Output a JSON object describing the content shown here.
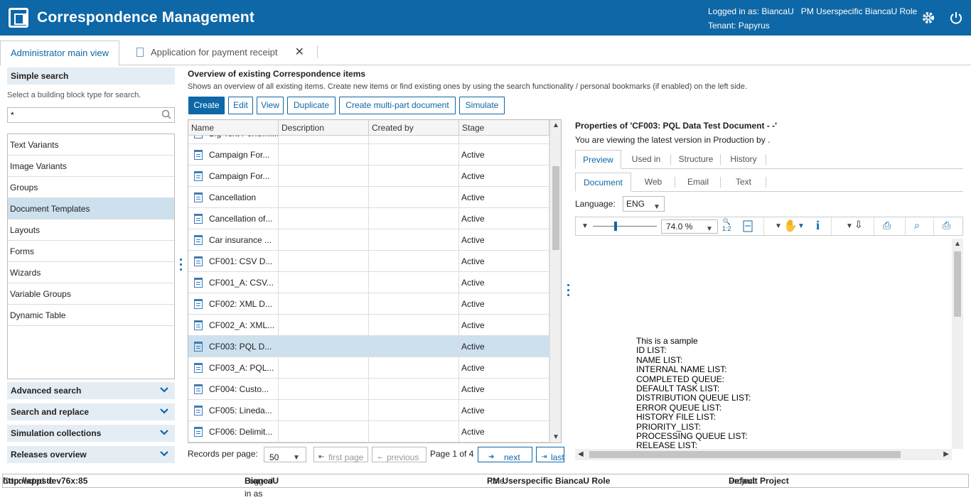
{
  "header": {
    "app_title": "Correspondence Management",
    "logged_in_label": "Logged in as:",
    "user": "BiancaU",
    "role": "PM Userspecific BiancaU Role",
    "tenant_label": "Tenant:",
    "tenant": "Papyrus",
    "icons": [
      "settings-gear-icon",
      "power-icon"
    ]
  },
  "tabs": [
    {
      "label": "Administrator main view",
      "active": true
    },
    {
      "label": "Application for payment receipt",
      "active": false
    }
  ],
  "left": {
    "simple_search_title": "Simple search",
    "hint": "Select a building block type for search.",
    "search_value": "*",
    "types": [
      "Text Variants",
      "Image Variants",
      "Groups",
      "Document Templates",
      "Layouts",
      "Forms",
      "Wizards",
      "Variable Groups",
      "Dynamic Table"
    ],
    "selected_type": "Document Templates",
    "accordions": [
      "Advanced search",
      "Search and replace",
      "Simulation collections",
      "Releases overview"
    ]
  },
  "center": {
    "title": "Overview of existing Correspondence items",
    "subtitle": "Shows an overview of all existing items. Create new items or find existing ones by using the search functionality / personal bookmarks (if enabled) on the left side.",
    "buttons": [
      "Create",
      "Edit",
      "View",
      "Duplicate",
      "Create multi-part document",
      "Simulate"
    ],
    "columns": [
      "Name",
      "Description",
      "Created by",
      "Stage"
    ],
    "partial_row": "Big Text Perform...",
    "rows": [
      {
        "name": "Campaign For...",
        "stage": "Active"
      },
      {
        "name": "Campaign For...",
        "stage": "Active"
      },
      {
        "name": "Cancellation",
        "stage": "Active"
      },
      {
        "name": "Cancellation of...",
        "stage": "Active"
      },
      {
        "name": "Car insurance ...",
        "stage": "Active"
      },
      {
        "name": "CF001: CSV D...",
        "stage": "Active"
      },
      {
        "name": "CF001_A: CSV...",
        "stage": "Active"
      },
      {
        "name": "CF002: XML D...",
        "stage": "Active"
      },
      {
        "name": "CF002_A: XML...",
        "stage": "Active"
      },
      {
        "name": "CF003: PQL D...",
        "stage": "Active",
        "selected": true
      },
      {
        "name": "CF003_A: PQL...",
        "stage": "Active"
      },
      {
        "name": "CF004: Custo...",
        "stage": "Active"
      },
      {
        "name": "CF005: Lineda...",
        "stage": "Active"
      },
      {
        "name": "CF006: Delimit...",
        "stage": "Active"
      }
    ],
    "pager": {
      "records_label": "Records per page:",
      "records_value": "50",
      "first": "first page",
      "previous": "previous",
      "page_info": "Page 1 of 4",
      "next": "next",
      "last": "last"
    }
  },
  "right": {
    "title": "Properties of 'CF003: PQL Data Test Document - -'",
    "subtitle": "You are viewing the latest version in Production by .",
    "tabs": [
      "Preview",
      "Used in",
      "Structure",
      "History"
    ],
    "subtabs": [
      "Document",
      "Web",
      "Email",
      "Text"
    ],
    "language_label": "Language:",
    "language": "ENG",
    "zoom": "74.0 %",
    "zoom_ratio": "1:2",
    "doc_lines": [
      "This is a sample",
      "ID LIST:",
      "NAME LIST:",
      "INTERNAL NAME LIST:",
      "COMPLETED QUEUE:",
      "DEFAULT TASK LIST:",
      "DISTRIBUTION QUEUE LIST:",
      "ERROR QUEUE LIST:",
      "HISTORY FILE LIST:",
      "PRIORITY_LIST:",
      "PROCESSING QUEUE LIST:",
      "RELEASE LIST:"
    ]
  },
  "status": {
    "connected_label": "Connected to",
    "connected": "http://appsdev76x:85",
    "logged_label": "Logged in as",
    "logged": "BiancaU",
    "role_label": "Role:",
    "role": "PM Userspecific BiancaU Role",
    "project_label": "Project:",
    "project": "Default Project"
  }
}
